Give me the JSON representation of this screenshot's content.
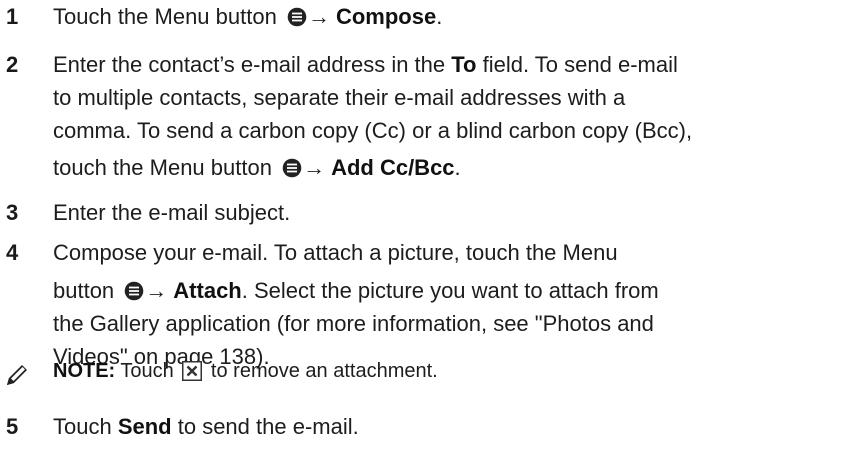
{
  "steps": [
    {
      "number": "1",
      "line1": {
        "pre": "Touch the Menu button",
        "arrow": "→",
        "bold": "Compose",
        "post": "."
      }
    },
    {
      "number": "2",
      "line1": {
        "pre": "Enter the contact’s e-mail address in the ",
        "bold": "To",
        "post": " field. To send e-mail"
      },
      "line2": "to multiple contacts, separate their e-mail addresses with a",
      "line3": "comma. To send a carbon copy (Cc) or a blind carbon copy (Bcc),",
      "line4": {
        "pre": "touch the Menu button",
        "arrow": "→",
        "bold": "Add Cc/Bcc",
        "post": "."
      }
    },
    {
      "number": "3",
      "line1": "Enter the e-mail subject."
    },
    {
      "number": "4",
      "line1": "Compose your e-mail. To attach a picture, touch the Menu",
      "line2": {
        "pre": "button",
        "arrow": "→",
        "bold": "Attach",
        "post": ". Select the picture you want to attach from"
      },
      "line3": "the Gallery application (for more information, see \"Photos and",
      "line4": "Videos\" on page 138)."
    },
    {
      "number": "5",
      "line1": {
        "pre": "Touch ",
        "bold": "Send",
        "post": " to send the e-mail."
      }
    }
  ],
  "note": {
    "label": "NOTE:",
    "pre": " Touch",
    "post": "to remove an attachment."
  },
  "icons": {
    "menu": "menu-button-icon",
    "note": "pencil-note-icon",
    "remove": "close-box-icon"
  },
  "colors": {
    "text": "#1d1d1d",
    "icon": "#222222"
  }
}
